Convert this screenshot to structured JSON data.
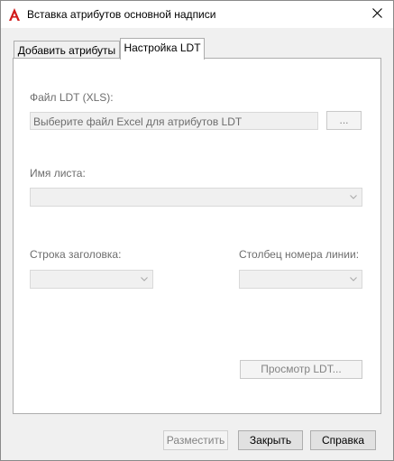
{
  "window": {
    "title": "Вставка атрибутов основной надписи"
  },
  "tabs": [
    {
      "label": "Добавить атрибуты",
      "active": false
    },
    {
      "label": "Настройка LDT",
      "active": true
    }
  ],
  "form": {
    "file_label": "Файл LDT (XLS):",
    "file_placeholder": "Выберите файл Excel для атрибутов LDT",
    "browse_label": "...",
    "sheet_label": "Имя листа:",
    "sheet_value": "",
    "header_row_label": "Строка заголовка:",
    "header_row_value": "",
    "line_column_label": "Столбец номера линии:",
    "line_column_value": "",
    "preview_label": "Просмотр LDT..."
  },
  "footer": {
    "place_label": "Разместить",
    "close_label": "Закрыть",
    "help_label": "Справка"
  },
  "colors": {
    "logo_red": "#d11a1a",
    "disabled_text": "#838383"
  }
}
